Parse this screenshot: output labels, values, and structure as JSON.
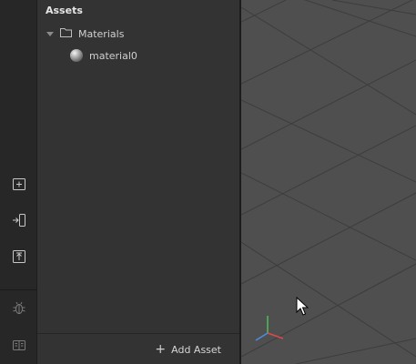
{
  "rail": {
    "icons": [
      {
        "name": "new-folder-icon"
      },
      {
        "name": "import-icon"
      },
      {
        "name": "upload-icon"
      },
      {
        "name": "bug-icon"
      },
      {
        "name": "docs-icon"
      }
    ]
  },
  "assets": {
    "title": "Assets",
    "tree": {
      "folder_label": "Materials",
      "items": [
        {
          "label": "material0",
          "icon": "sphere-material-icon"
        }
      ]
    },
    "footer": {
      "add_label": "Add Asset",
      "add_icon": "+"
    }
  },
  "viewport": {
    "background": "#4f4f4f",
    "grid_color": "#3a3a3a",
    "axis_colors": {
      "x": "#d94b4b",
      "y": "#4fbf5a",
      "z": "#4a8fe0"
    }
  }
}
